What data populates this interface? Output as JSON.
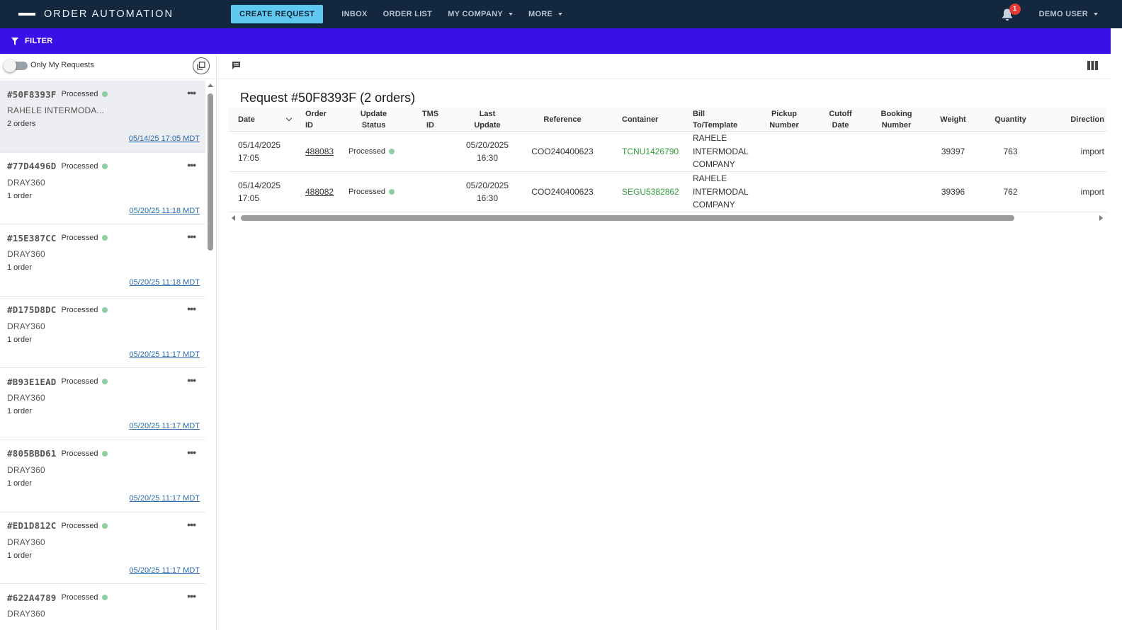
{
  "app": {
    "title": "ORDER AUTOMATION"
  },
  "nav": {
    "create_request": "CREATE REQUEST",
    "inbox": "INBOX",
    "order_list": "ORDER LIST",
    "my_company": "MY COMPANY",
    "more": "MORE",
    "notifications_count": "1",
    "user": "DEMO USER"
  },
  "filterbar": {
    "label": "FILTER"
  },
  "sidebar": {
    "toggle_label": "Only My Requests",
    "requests": [
      {
        "id": "#50F8393F",
        "status": "Processed",
        "company": "RAHELE INTERMODA...",
        "orders": "2 orders",
        "date": "05/14/25 17:05 MDT"
      },
      {
        "id": "#77D4496D",
        "status": "Processed",
        "company": "DRAY360",
        "orders": "1 order",
        "date": "05/20/25 11:18 MDT"
      },
      {
        "id": "#15E387CC",
        "status": "Processed",
        "company": "DRAY360",
        "orders": "1 order",
        "date": "05/20/25 11:18 MDT"
      },
      {
        "id": "#D175D8DC",
        "status": "Processed",
        "company": "DRAY360",
        "orders": "1 order",
        "date": "05/20/25 11:17 MDT"
      },
      {
        "id": "#B93E1EAD",
        "status": "Processed",
        "company": "DRAY360",
        "orders": "1 order",
        "date": "05/20/25 11:17 MDT"
      },
      {
        "id": "#805BBD61",
        "status": "Processed",
        "company": "DRAY360",
        "orders": "1 order",
        "date": "05/20/25 11:17 MDT"
      },
      {
        "id": "#ED1D812C",
        "status": "Processed",
        "company": "DRAY360",
        "orders": "1 order",
        "date": "05/20/25 11:17 MDT"
      },
      {
        "id": "#622A4789",
        "status": "Processed",
        "company": "DRAY360",
        "orders": "",
        "date": ""
      }
    ]
  },
  "main": {
    "title": "Request #50F8393F (2 orders)",
    "columns": {
      "date": "Date",
      "order_id_1": "Order",
      "order_id_2": "ID",
      "update_status_1": "Update",
      "update_status_2": "Status",
      "tms_id_1": "TMS",
      "tms_id_2": "ID",
      "last_update_1": "Last",
      "last_update_2": "Update",
      "reference": "Reference",
      "container": "Container",
      "bill_to_1": "Bill",
      "bill_to_2": "To/Template",
      "pickup_1": "Pickup",
      "pickup_2": "Number",
      "cutoff_1": "Cutoff",
      "cutoff_2": "Date",
      "booking_1": "Booking",
      "booking_2": "Number",
      "weight": "Weight",
      "quantity": "Quantity",
      "direction": "Direction"
    },
    "rows": [
      {
        "date_1": "05/14/2025",
        "date_2": "17:05",
        "order_id": "488083",
        "status": "Processed",
        "last_1": "05/20/2025",
        "last_2": "16:30",
        "reference": "COO240400623",
        "container": "TCNU1426790",
        "bill_1": "RAHELE",
        "bill_2": "INTERMODAL",
        "bill_3": "COMPANY",
        "weight": "39397",
        "quantity": "763",
        "direction": "import"
      },
      {
        "date_1": "05/14/2025",
        "date_2": "17:05",
        "order_id": "488082",
        "status": "Processed",
        "last_1": "05/20/2025",
        "last_2": "16:30",
        "reference": "COO240400623",
        "container": "SEGU5382862",
        "bill_1": "RAHELE",
        "bill_2": "INTERMODAL",
        "bill_3": "COMPANY",
        "weight": "39396",
        "quantity": "762",
        "direction": "import"
      }
    ]
  },
  "colors": {
    "topbar": "#13273e",
    "filterbar": "#3a10e8",
    "create_button": "#5ec8ee",
    "status_dot": "#8fcea2",
    "container_link": "#2e9e3c"
  }
}
